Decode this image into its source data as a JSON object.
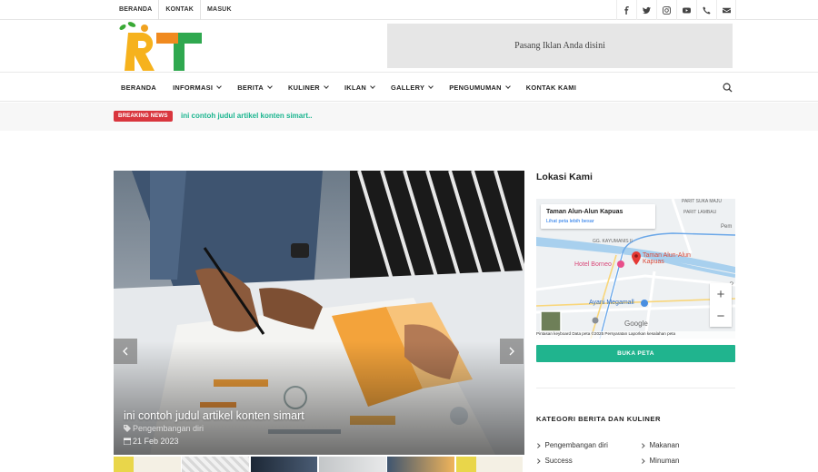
{
  "topbar": {
    "links": [
      "BERANDA",
      "KONTAK",
      "MASUK"
    ],
    "socials": [
      "facebook-icon",
      "twitter-icon",
      "instagram-icon",
      "youtube-icon",
      "phone-icon",
      "mail-icon"
    ]
  },
  "header": {
    "logo_letters": "RT",
    "ad_text": "Pasang Iklan Anda disini"
  },
  "nav": {
    "items": [
      {
        "label": "BERANDA",
        "dropdown": false
      },
      {
        "label": "INFORMASI",
        "dropdown": true
      },
      {
        "label": "BERITA",
        "dropdown": true
      },
      {
        "label": "KULINER",
        "dropdown": true
      },
      {
        "label": "IKLAN",
        "dropdown": true
      },
      {
        "label": "GALLERY",
        "dropdown": true
      },
      {
        "label": "PENGUMUMAN",
        "dropdown": true
      },
      {
        "label": "KONTAK KAMI",
        "dropdown": false
      }
    ]
  },
  "breaking": {
    "badge": "BREAKING NEWS",
    "headline": "ini contoh judul artikel konten simart.."
  },
  "slider": {
    "title": "ini contoh judul artikel konten simart",
    "category": "Pengembangan diri",
    "date": "21 Feb 2023"
  },
  "sidebar": {
    "location_title": "Lokasi Kami",
    "map": {
      "place_name": "Taman Alun-Alun Kapuas",
      "view_larger": "Lihat peta lebih besar",
      "pin_label": "Taman Alun-Alun Kapuas",
      "poi_hotel": "Hotel Borneo",
      "poi_mall": "Ayani Megamall",
      "area_labels": [
        "PARIT SUKA MAJU",
        "PARIT LAMBAU",
        "GG. KAYUMANIS II",
        "Pem",
        "P"
      ],
      "zoom_in": "+",
      "zoom_out": "−",
      "footer": "Pintasan keyboard   Data peta ©2025   Persyaratan   Laporkan kesalahan peta",
      "brand": "Google"
    },
    "map_button": "BUKA PETA",
    "category_title": "KATEGORI BERITA DAN KULINER",
    "categories": [
      "Pengembangan diri",
      "Makanan",
      "Success",
      "Minuman"
    ]
  },
  "colors": {
    "accent": "#20b48e",
    "breaking_red": "#d9363e"
  }
}
